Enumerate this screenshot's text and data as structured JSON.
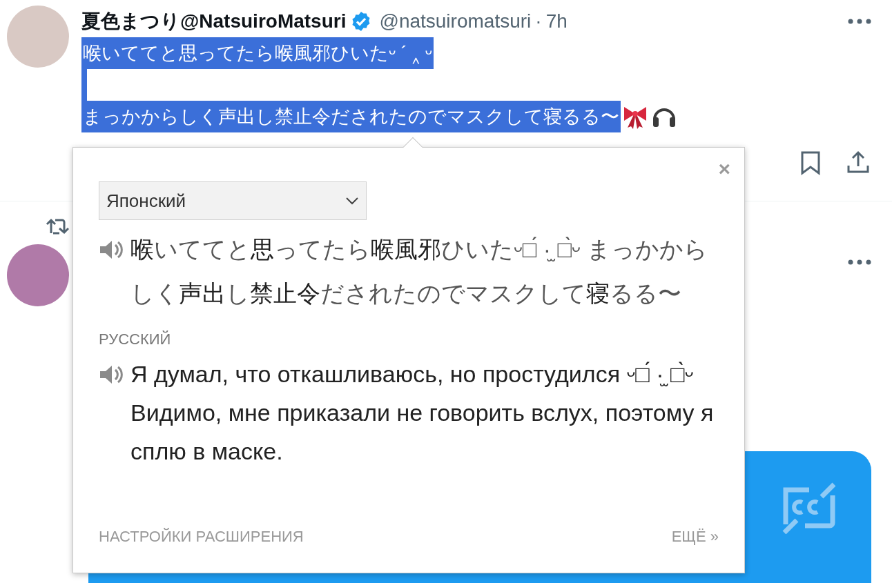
{
  "tweet": {
    "author_name": "夏色まつり@NatsuiroMatsuri",
    "verified": true,
    "handle": "@natsuiromatsuri",
    "separator": "·",
    "time": "7h",
    "selected": true,
    "lines": [
      "喉いててと思ってたら喉風邪ひいたᵕ ´ ‸ ᵕ",
      "まっかからしく声出し禁止令だされたのでマスクして寝るる〜"
    ]
  },
  "translator": {
    "source_language": "Японский",
    "close": "×",
    "source_text": "**喉**いててと**思**ってたら**喉風邪**ひいたᵕ□́ ·̫ □̀ᵕ まっかからしく**声出**し**禁止令**だされたのでマスクして**寝**るる〜",
    "target_language": "РУССКИЙ",
    "translation": "Я думал, что откашливаюсь, но простудился ᵕ□́ ·̫ □̀ᵕ Видимо, мне приказали не говорить вслух, поэтому я сплю в маске.",
    "footer_left": "НАСТРОЙКИ РАСШИРЕНИЯ",
    "footer_right": "ЕЩЁ »"
  }
}
